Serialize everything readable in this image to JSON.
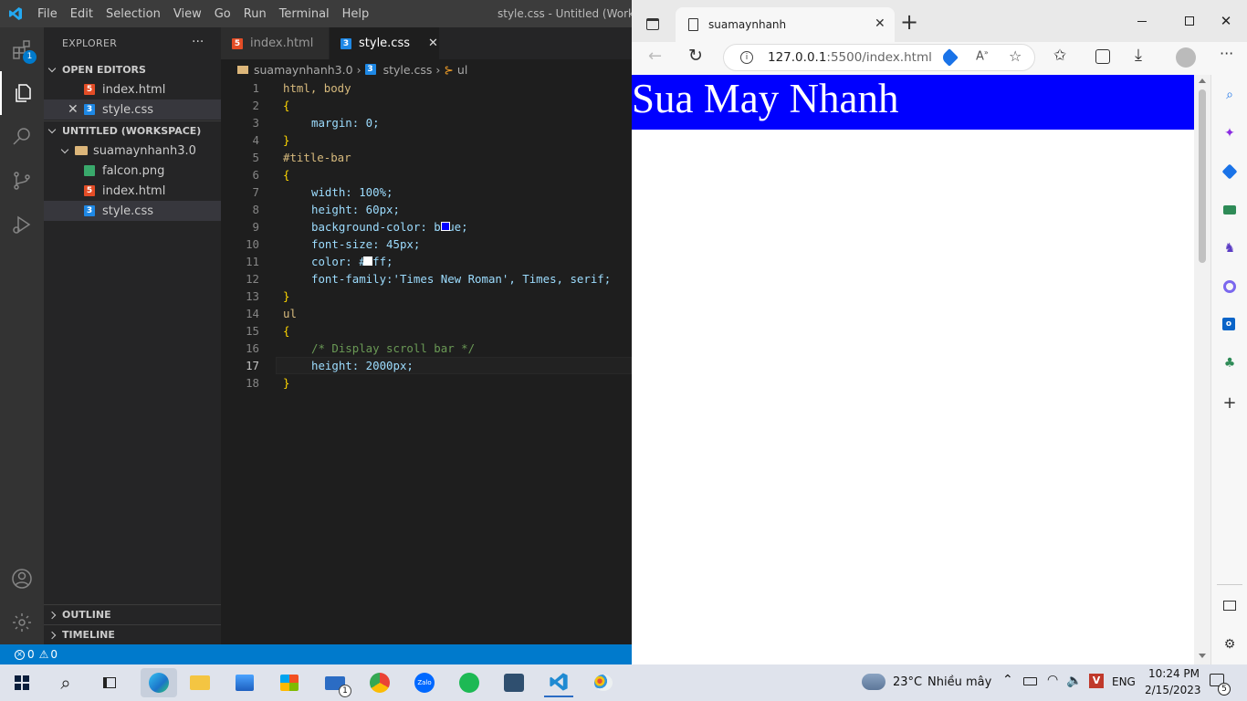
{
  "vscode": {
    "menu": [
      "File",
      "Edit",
      "Selection",
      "View",
      "Go",
      "Run",
      "Terminal",
      "Help"
    ],
    "window_title": "style.css - Untitled (Workspace)",
    "explorer_header": "EXPLORER",
    "explorer_more": "···",
    "activity_badge": "1",
    "open_editors_label": "OPEN EDITORS",
    "open_editors": [
      {
        "name": "index.html",
        "type": "html"
      },
      {
        "name": "style.css",
        "type": "css"
      }
    ],
    "workspace_label": "UNTITLED (WORKSPACE)",
    "folder": "suamaynhanh3.0",
    "files": [
      {
        "name": "falcon.png",
        "type": "img"
      },
      {
        "name": "index.html",
        "type": "html"
      },
      {
        "name": "style.css",
        "type": "css"
      }
    ],
    "outline_label": "OUTLINE",
    "timeline_label": "TIMELINE",
    "tabs": [
      {
        "name": "index.html",
        "type": "html"
      },
      {
        "name": "style.css",
        "type": "css",
        "active": true
      }
    ],
    "breadcrumb": {
      "folder": "suamaynhanh3.0",
      "file": "style.css",
      "symbol": "ul"
    },
    "code_lines": [
      "html, body",
      "{",
      "margin: 0;",
      "}",
      "#title-bar",
      "{",
      "width: 100%;",
      "height: 60px;",
      "background-color: blue;",
      "font-size: 45px;",
      "color: #fff;",
      "font-family:'Times New Roman', Times, serif;",
      "}",
      "ul",
      "{",
      "/* Display scroll bar */",
      "height: 2000px;",
      "}"
    ],
    "active_line": 17,
    "status": {
      "errors": "0",
      "warnings": "0"
    },
    "swatch_colors": {
      "blue": "#0000ff",
      "white": "#ffffff"
    }
  },
  "browser": {
    "tab_title": "suamaynhanh",
    "url_host": "127.0.0.1",
    "url_rest": ":5500/index.html",
    "page_title": "Sua May Nhanh",
    "page_bg": "#0000ff"
  },
  "taskbar": {
    "weather_temp": "23°C",
    "weather_text": "Nhiều mây",
    "lang": "ENG",
    "time": "10:24 PM",
    "date": "2/15/2023",
    "notif_count": "5",
    "mail_badge": "1"
  }
}
